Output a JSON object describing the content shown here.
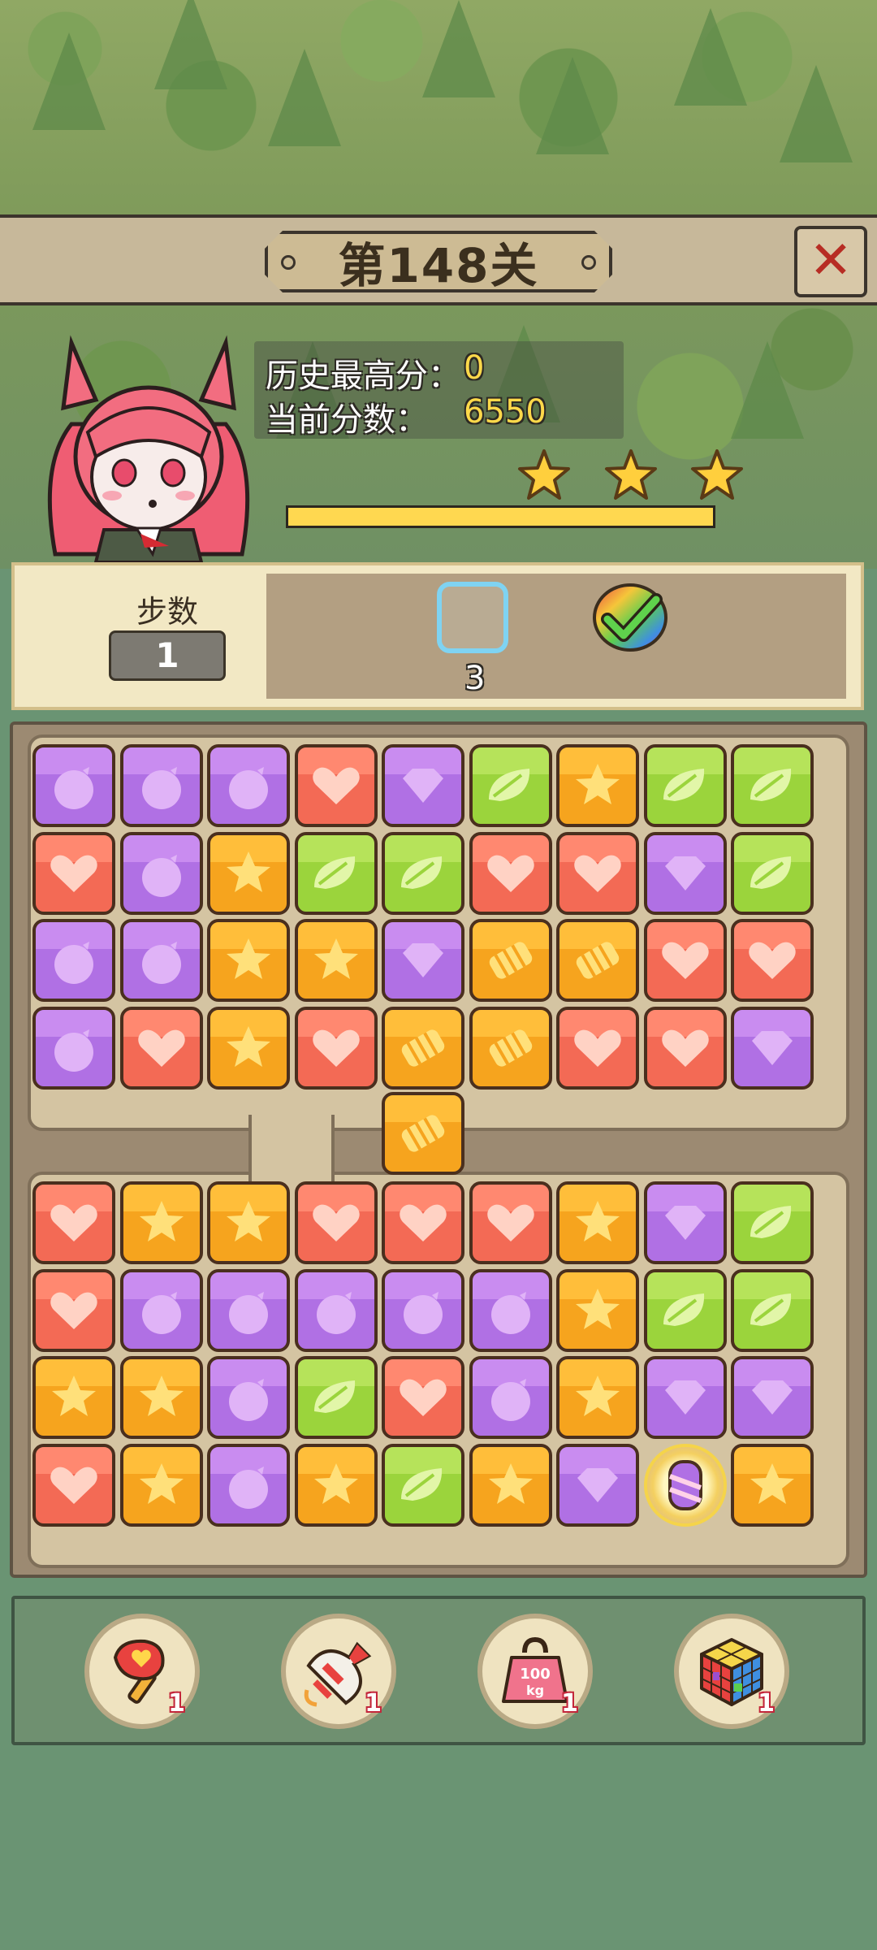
{
  "level": {
    "title": "第148关"
  },
  "score": {
    "best_label": "历史最高分：",
    "best_value": "0",
    "current_label": "当前分数：",
    "current_value": "6550",
    "progress": 1.0,
    "stars_earned": 3
  },
  "goals": {
    "steps_label": "步数",
    "steps_value": "1",
    "target_count": "3",
    "target_icon": "empty-cell-icon",
    "completed_icon": "rainbow-check-icon"
  },
  "board": {
    "top": [
      [
        "purple",
        "purple",
        "purple",
        "red",
        "purple-gem",
        "green",
        "orange",
        "green",
        "green"
      ],
      [
        "red",
        "purple",
        "orange",
        "green",
        "green",
        "red",
        "red",
        "purple-gem",
        "green"
      ],
      [
        "purple",
        "purple",
        "orange",
        "orange",
        "purple-gem",
        "orange-candy",
        "orange-candy",
        "red",
        "red"
      ],
      [
        "purple",
        "red",
        "orange",
        "red",
        "orange-candy",
        "orange-candy",
        "red",
        "red",
        "purple-gem"
      ]
    ],
    "bridge": "orange-candy",
    "bottom": [
      [
        "red",
        "orange",
        "orange",
        "red",
        "red",
        "red",
        "orange",
        "purple-gem",
        "green"
      ],
      [
        "red",
        "purple",
        "purple",
        "purple",
        "purple",
        "purple",
        "orange",
        "green",
        "green"
      ],
      [
        "orange",
        "orange",
        "purple",
        "green",
        "red",
        "purple",
        "orange",
        "purple-gem",
        "purple-gem"
      ],
      [
        "red",
        "orange",
        "purple",
        "orange",
        "green",
        "orange",
        "purple-gem",
        "special",
        "orange"
      ]
    ]
  },
  "tools": [
    {
      "icon": "hammer-icon",
      "count": "1"
    },
    {
      "icon": "rocket-icon",
      "count": "1"
    },
    {
      "icon": "weight-100kg-icon",
      "count": "1",
      "weight_text": "100 kg"
    },
    {
      "icon": "rubik-cube-icon",
      "count": "1"
    }
  ],
  "colors": {
    "purple": "#b070e4",
    "red": "#f36a55",
    "orange": "#f6a41e",
    "green": "#9bd43c",
    "progress": "#ffd850"
  }
}
